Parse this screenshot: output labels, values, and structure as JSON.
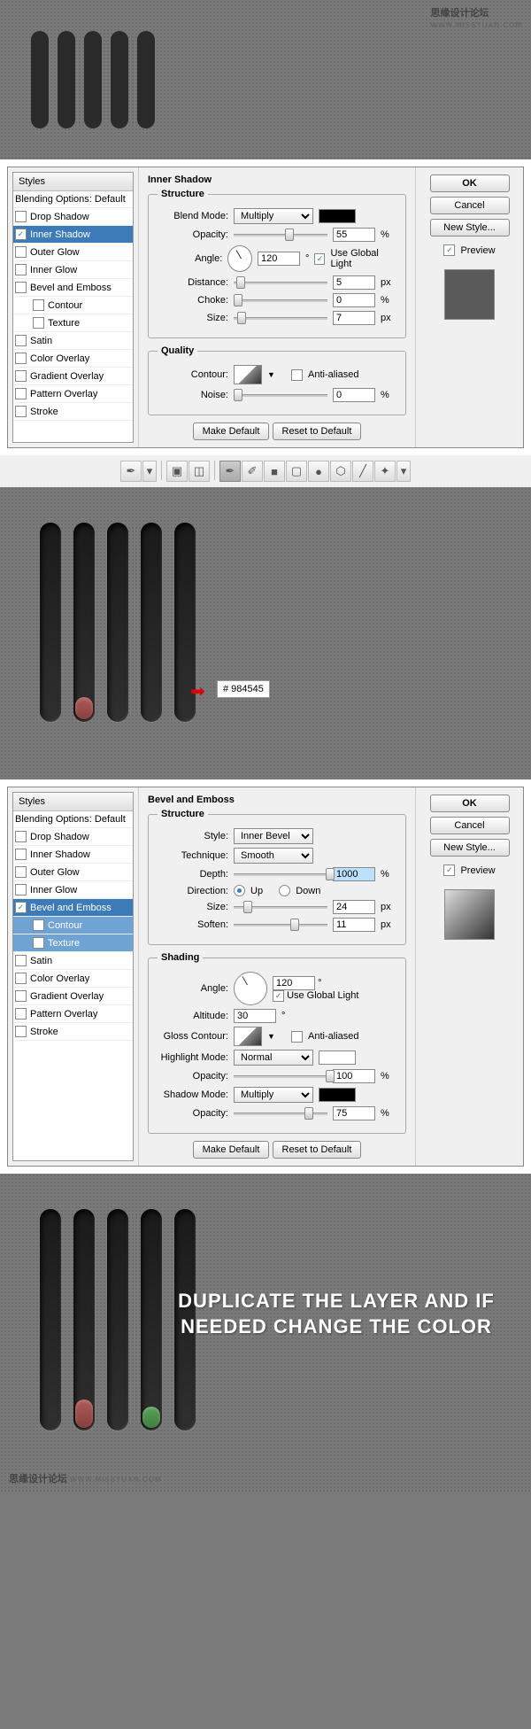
{
  "watermark": {
    "title": "思缘设计论坛",
    "sub": "WWW.MISSYUAN.COM"
  },
  "stylesPanel": {
    "header": "Styles",
    "blendingOptions": "Blending Options: Default",
    "items": [
      {
        "label": "Drop Shadow",
        "checked": false
      },
      {
        "label": "Inner Shadow",
        "checked": true
      },
      {
        "label": "Outer Glow",
        "checked": false
      },
      {
        "label": "Inner Glow",
        "checked": false
      },
      {
        "label": "Bevel and Emboss",
        "checked": false
      },
      {
        "label": "Contour",
        "checked": false,
        "indent": true
      },
      {
        "label": "Texture",
        "checked": false,
        "indent": true
      },
      {
        "label": "Satin",
        "checked": false
      },
      {
        "label": "Color Overlay",
        "checked": false
      },
      {
        "label": "Gradient Overlay",
        "checked": false
      },
      {
        "label": "Pattern Overlay",
        "checked": false
      },
      {
        "label": "Stroke",
        "checked": false
      }
    ]
  },
  "innerShadow": {
    "title": "Inner Shadow",
    "structure": "Structure",
    "blendModeLabel": "Blend Mode:",
    "blendMode": "Multiply",
    "opacityLabel": "Opacity:",
    "opacity": "55",
    "angleLabel": "Angle:",
    "angle": "120",
    "angleUnit": "°",
    "useGlobal": "Use Global Light",
    "distanceLabel": "Distance:",
    "distance": "5",
    "chokeLabel": "Choke:",
    "choke": "0",
    "sizeLabel": "Size:",
    "size": "7",
    "quality": "Quality",
    "contourLabel": "Contour:",
    "antiAliased": "Anti-aliased",
    "noiseLabel": "Noise:",
    "noise": "0",
    "pct": "%",
    "px": "px",
    "makeDefault": "Make Default",
    "resetDefault": "Reset to Default"
  },
  "bevel": {
    "title": "Bevel and Emboss",
    "structure": "Structure",
    "styleLabel": "Style:",
    "style": "Inner Bevel",
    "techLabel": "Technique:",
    "tech": "Smooth",
    "depthLabel": "Depth:",
    "depth": "1000",
    "directionLabel": "Direction:",
    "up": "Up",
    "down": "Down",
    "sizeLabel": "Size:",
    "size": "24",
    "softenLabel": "Soften:",
    "soften": "11",
    "shading": "Shading",
    "angleLabel": "Angle:",
    "angle": "120",
    "angleUnit": "°",
    "useGlobal": "Use Global Light",
    "altitudeLabel": "Altitude:",
    "altitude": "30",
    "glossLabel": "Gloss Contour:",
    "antiAliased": "Anti-aliased",
    "highlightLabel": "Highlight Mode:",
    "highlight": "Normal",
    "opacityLabel": "Opacity:",
    "hOpacity": "100",
    "shadowLabel": "Shadow Mode:",
    "shadow": "Multiply",
    "sOpacity": "75",
    "pct": "%",
    "px": "px",
    "makeDefault": "Make Default",
    "resetDefault": "Reset to Default"
  },
  "rightPanel": {
    "ok": "OK",
    "cancel": "Cancel",
    "newStyle": "New Style...",
    "preview": "Preview"
  },
  "colorSwatch": {
    "hash": "#  984545"
  },
  "instruction": "DUPLICATE THE LAYER AND IF NEEDED CHANGE THE COLOR"
}
